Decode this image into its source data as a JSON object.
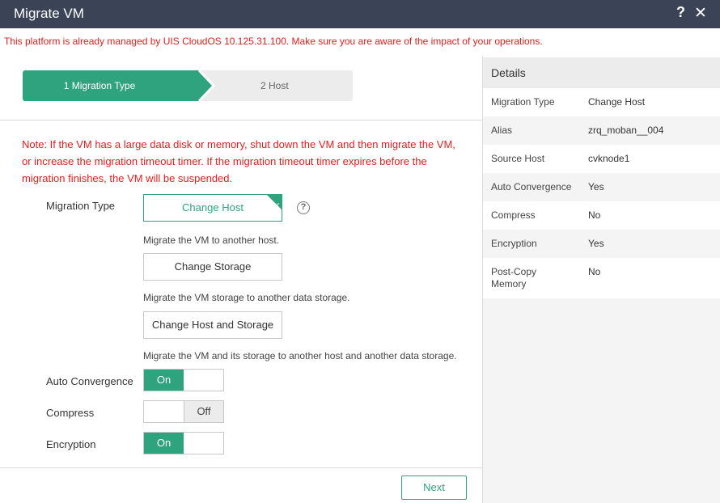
{
  "window": {
    "title": "Migrate VM",
    "help_glyph": "?",
    "close_glyph": "✕"
  },
  "warning": "This platform is already managed by UIS CloudOS 10.125.31.100. Make sure you are aware of the impact of your operations.",
  "steps": [
    {
      "label": "1 Migration Type",
      "active": true
    },
    {
      "label": "2 Host",
      "active": false
    }
  ],
  "note": "Note: If the VM has a large data disk or memory, shut down the VM and then migrate the VM, or increase the migration timeout timer. If the migration timeout timer expires before the migration finishes, the VM will be suspended.",
  "form": {
    "migration_type_label": "Migration Type",
    "help_icon_glyph": "?",
    "options": [
      {
        "label": "Change Host",
        "desc": "Migrate the VM to another host.",
        "selected": true
      },
      {
        "label": "Change Storage",
        "desc": "Migrate the VM storage to another data storage.",
        "selected": false
      },
      {
        "label": "Change Host and Storage",
        "desc": "Migrate the VM and its storage to another host and another data storage.",
        "selected": false
      }
    ],
    "toggles": [
      {
        "label": "Auto Convergence",
        "state_text": "On",
        "on": true
      },
      {
        "label": "Compress",
        "state_text": "Off",
        "on": false
      },
      {
        "label": "Encryption",
        "state_text": "On",
        "on": true
      }
    ]
  },
  "footer": {
    "next_label": "Next"
  },
  "details": {
    "heading": "Details",
    "rows": [
      {
        "key": "Migration Type",
        "value": "Change Host"
      },
      {
        "key": "Alias",
        "value": "zrq_moban__004"
      },
      {
        "key": "Source Host",
        "value": "cvknode1"
      },
      {
        "key": "Auto Convergence",
        "value": "Yes"
      },
      {
        "key": "Compress",
        "value": "No"
      },
      {
        "key": "Encryption",
        "value": "Yes"
      },
      {
        "key": "Post-Copy Memory",
        "value": "No"
      }
    ]
  },
  "colors": {
    "accent": "#2ea37e",
    "titlebar": "#3b4456",
    "warning_red": "#e02020"
  }
}
